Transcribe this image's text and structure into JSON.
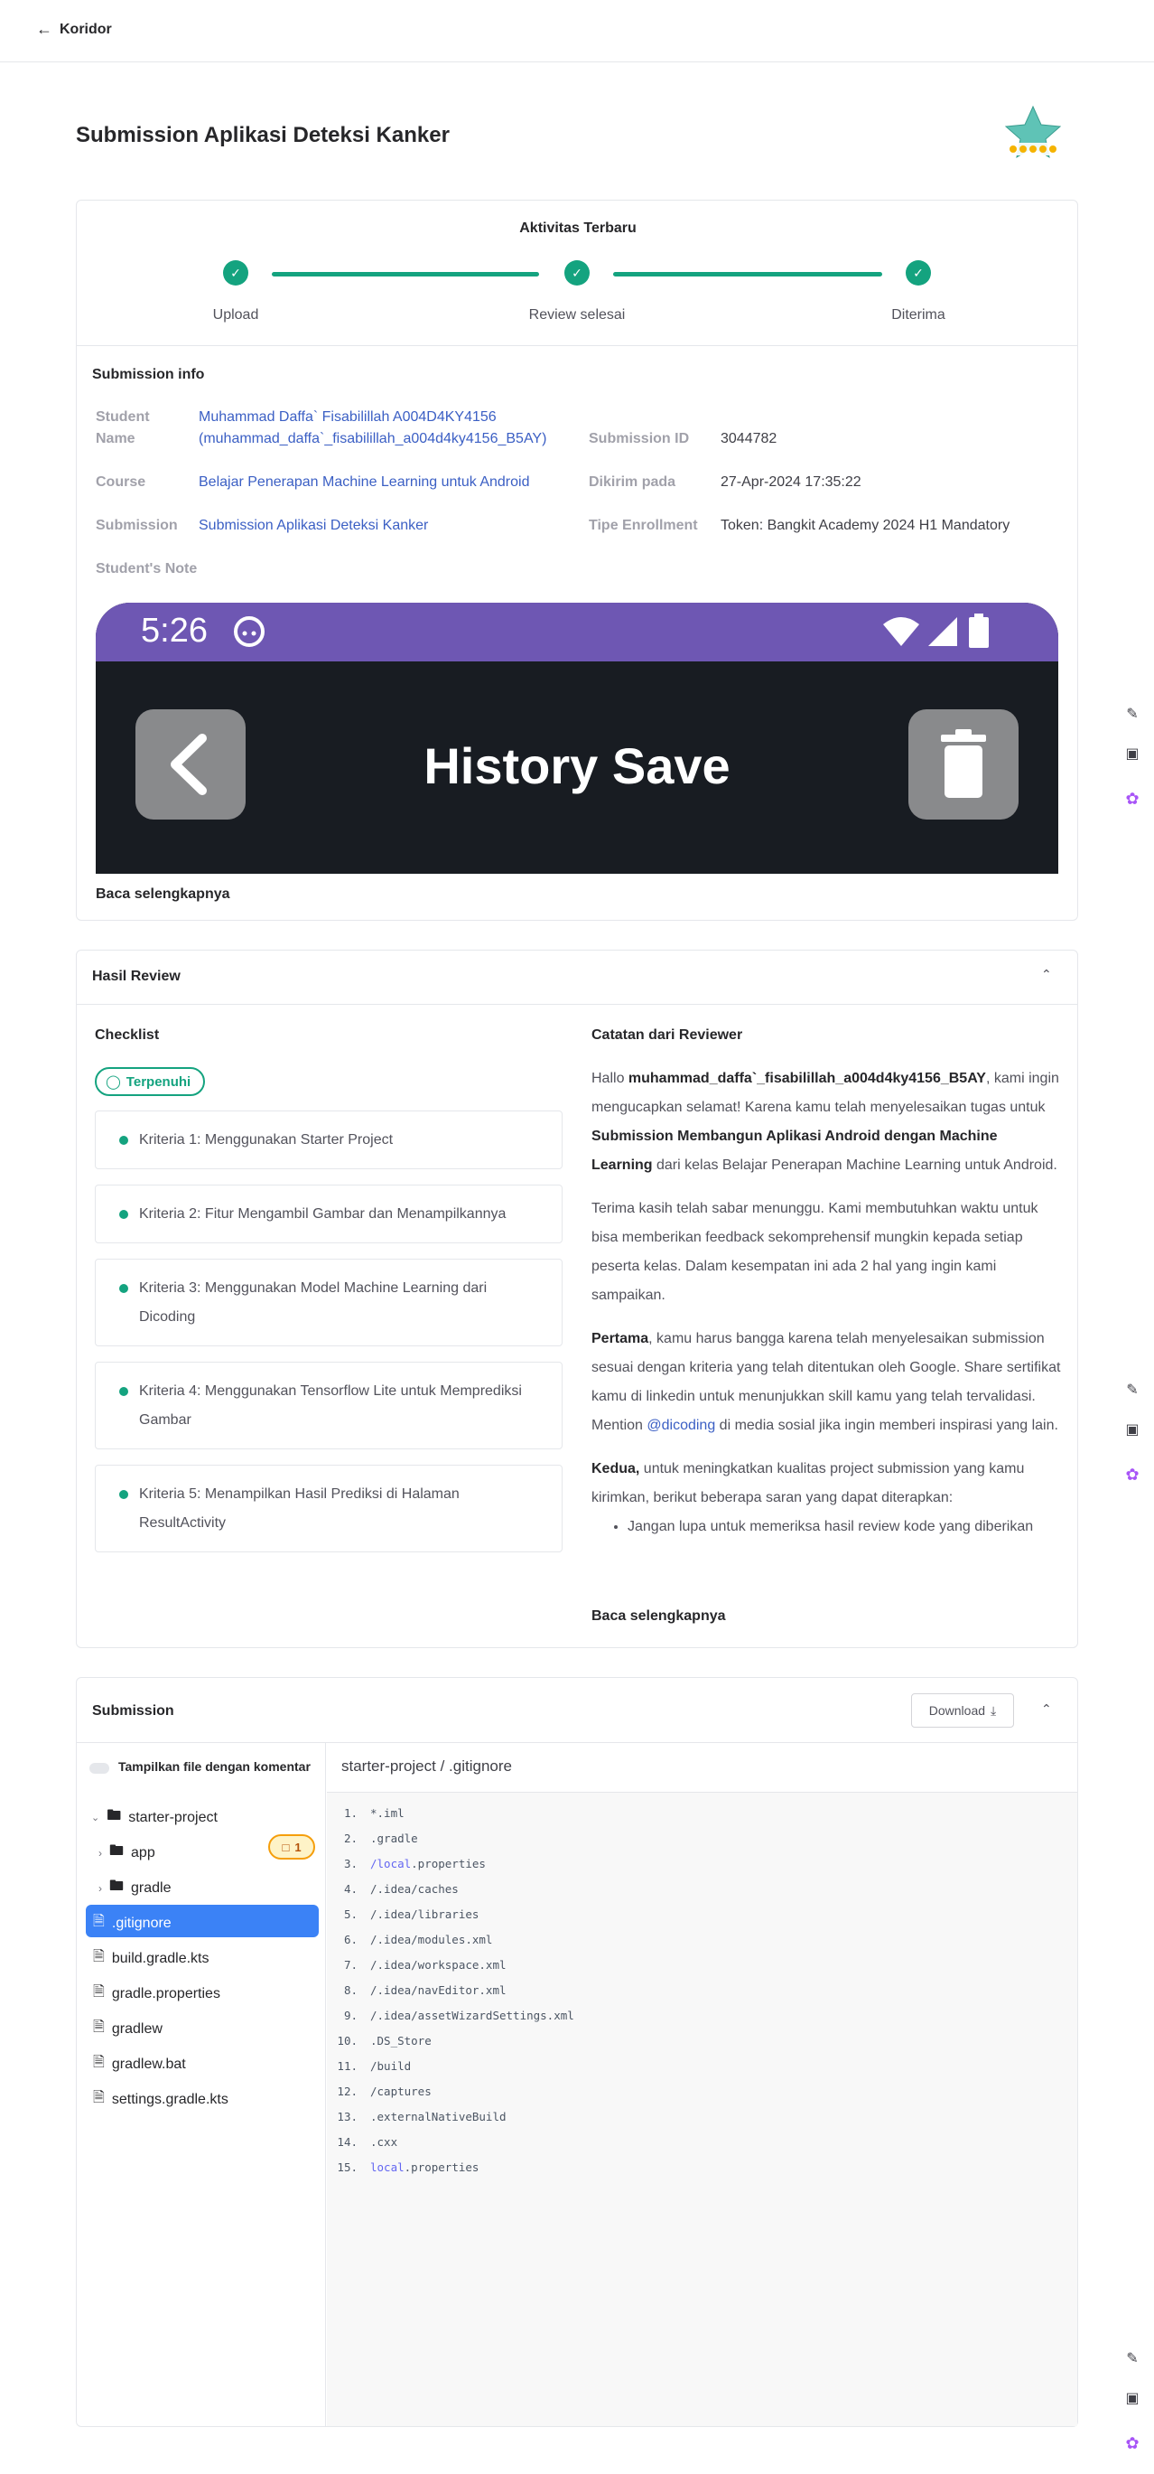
{
  "nav": {
    "back_label": "Koridor"
  },
  "page": {
    "title": "Submission Aplikasi Deteksi Kanker"
  },
  "activity": {
    "title": "Aktivitas Terbaru",
    "steps": [
      {
        "label": "Upload"
      },
      {
        "label": "Review selesai"
      },
      {
        "label": "Diterima"
      }
    ]
  },
  "info": {
    "title": "Submission info",
    "student_label": "Student Name",
    "student_value_line1": "Muhammad Daffa` Fisabilillah A004D4KY4156",
    "student_value_line2": "(muhammad_daffa`_fisabilillah_a004d4ky4156_B5AY)",
    "course_label": "Course",
    "course_value": "Belajar Penerapan Machine Learning untuk Android",
    "submission_label": "Submission",
    "submission_value": "Submission Aplikasi Deteksi Kanker",
    "note_label": "Student's Note",
    "submission_id_label": "Submission ID",
    "submission_id_value": "3044782",
    "sent_label": "Dikirim pada",
    "sent_value": "27-Apr-2024 17:35:22",
    "enroll_label": "Tipe Enrollment",
    "enroll_value": "Token: Bangkit Academy 2024 H1 Mandatory",
    "banner_time": "5:26",
    "banner_title": "History Save",
    "read_more": "Baca selengkapnya"
  },
  "review": {
    "title": "Hasil Review",
    "checklist_title": "Checklist",
    "status_pill": "Terpenuhi",
    "criteria": [
      "Kriteria 1: Menggunakan Starter Project",
      "Kriteria 2: Fitur Mengambil Gambar dan Menampilkannya",
      "Kriteria 3: Menggunakan Model Machine Learning dari Dicoding",
      "Kriteria 4: Menggunakan Tensorflow Lite untuk Memprediksi Gambar",
      "Kriteria 5: Menampilkan Hasil Prediksi di Halaman ResultActivity"
    ],
    "notes_title": "Catatan dari Reviewer",
    "p1_a": "Hallo ",
    "p1_name": "muhammad_daffa`_fisabilillah_a004d4ky4156_B5AY",
    "p1_b": ", kami ingin mengucapkan selamat! Karena kamu telah menyelesaikan tugas untuk ",
    "p1_sub": "Submission Membangun Aplikasi Android dengan Machine Learning",
    "p1_c": " dari kelas Belajar Penerapan Machine Learning untuk Android.",
    "p2": "Terima kasih telah sabar menunggu. Kami membutuhkan waktu untuk bisa memberikan feedback sekomprehensif mungkin kepada setiap peserta kelas. Dalam kesempatan ini ada 2 hal yang ingin kami sampaikan.",
    "p3_bold": "Pertama",
    "p3_a": ", kamu harus bangga karena telah menyelesaikan submission sesuai dengan kriteria yang telah ditentukan oleh Google. Share sertifikat kamu di linkedin untuk menunjukkan skill kamu yang telah tervalidasi. Mention ",
    "p3_mention": "@dicoding",
    "p3_b": " di media sosial jika ingin memberi inspirasi yang lain.",
    "p4_bold": "Kedua,",
    "p4_a": " untuk meningkatkan kualitas project submission yang kamu kirimkan, berikut beberapa saran yang dapat diterapkan:",
    "bullet1": "Jangan lupa untuk memeriksa hasil review kode yang diberikan",
    "read_more": "Baca selengkapnya"
  },
  "submission": {
    "title": "Submission",
    "download_label": "Download",
    "toggle_label": "Tampilkan file dengan komentar",
    "path": "starter-project / .gitignore",
    "tree": {
      "root": "starter-project",
      "app": "app",
      "app_comments": "1",
      "gradle": "gradle",
      "files": [
        ".gitignore",
        "build.gradle.kts",
        "gradle.properties",
        "gradlew",
        "gradlew.bat",
        "settings.gradle.kts"
      ]
    },
    "code_lines": [
      {
        "n": "1.",
        "t": "*.iml"
      },
      {
        "n": "2.",
        "t": ".gradle"
      },
      {
        "n": "3.",
        "kw": "/local",
        "t": ".properties"
      },
      {
        "n": "4.",
        "t": "/.idea/caches"
      },
      {
        "n": "5.",
        "t": "/.idea/libraries"
      },
      {
        "n": "6.",
        "t": "/.idea/modules.xml"
      },
      {
        "n": "7.",
        "t": "/.idea/workspace.xml"
      },
      {
        "n": "8.",
        "t": "/.idea/navEditor.xml"
      },
      {
        "n": "9.",
        "t": "/.idea/assetWizardSettings.xml"
      },
      {
        "n": "10.",
        "t": ".DS_Store"
      },
      {
        "n": "11.",
        "t": "/build"
      },
      {
        "n": "12.",
        "t": "/captures"
      },
      {
        "n": "13.",
        "t": ".externalNativeBuild"
      },
      {
        "n": "14.",
        "t": ".cxx"
      },
      {
        "n": "15.",
        "kw": "local",
        "t": ".properties"
      }
    ]
  },
  "colors": {
    "accent": "#14a37f",
    "link": "#3b5fc4",
    "selected": "#3b82f6",
    "banner_status": "#6e57b3"
  }
}
